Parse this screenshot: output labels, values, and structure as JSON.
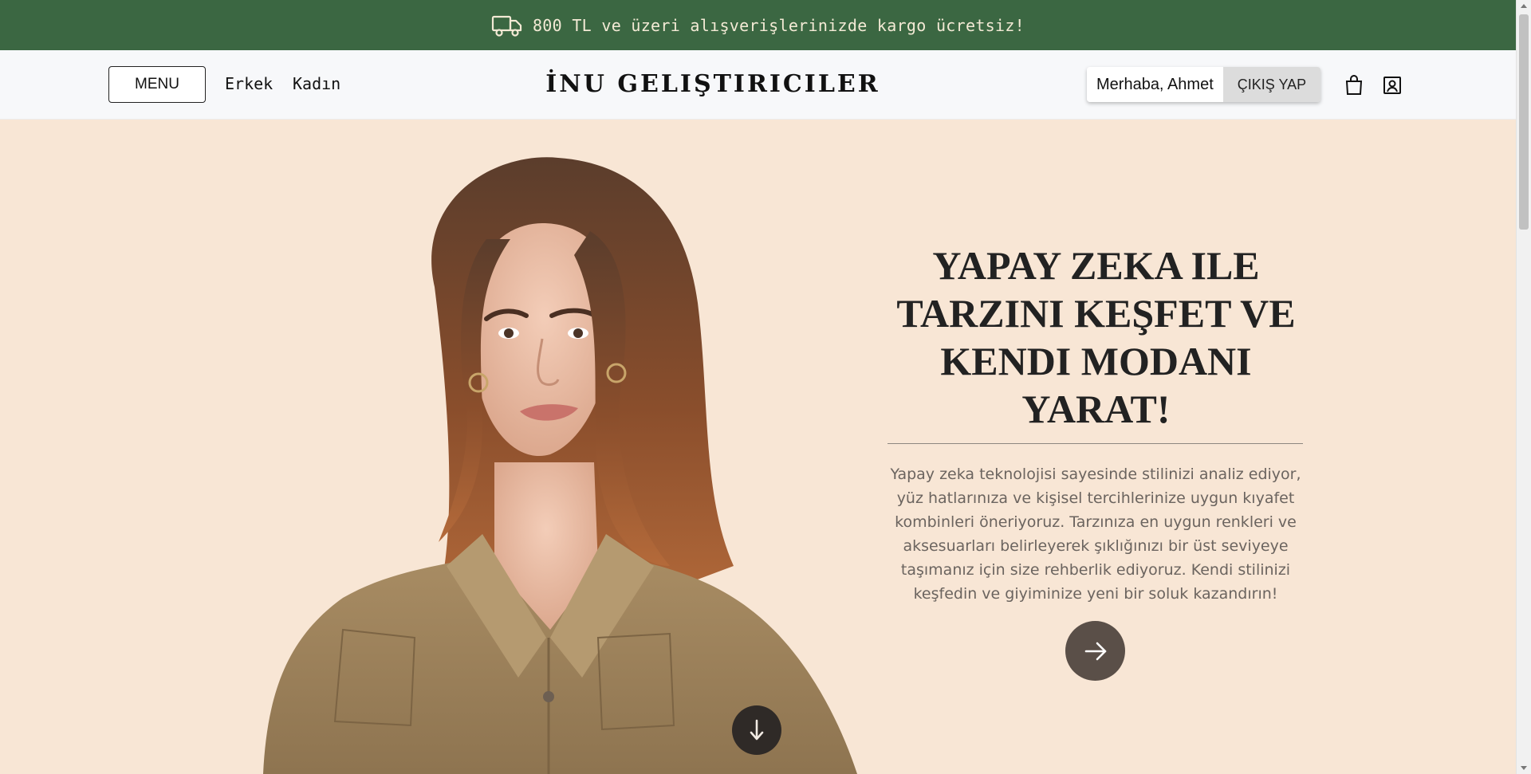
{
  "announcement": {
    "icon": "truck-icon",
    "text": "800 TL ve üzeri alışverişlerinizde kargo ücretsiz!"
  },
  "header": {
    "menu_label": "MENU",
    "nav": [
      "Erkek",
      "Kadın"
    ],
    "brand": "İNU GELIŞTIRICILER",
    "greeting": "Merhaba, Ahmet",
    "logout_label": "ÇIKIŞ YAP",
    "icons": [
      "shopping-bag-icon",
      "user-account-icon"
    ]
  },
  "hero": {
    "image": "woman-in-khaki-shirt-photo",
    "headline": "YAPAY ZEKA ILE TARZINI KEŞFET VE KENDI MODANI YARAT!",
    "description": "Yapay zeka teknolojisi sayesinde stilinizi analiz ediyor, yüz hatlarınıza ve kişisel tercihlerinize uygun kıyafet kombinleri öneriyoruz. Tarzınıza en uygun renkleri ve aksesuarları belirleyerek şıklığınızı bir üst seviyeye taşımanız için size rehberlik ediyoruz. Kendi stilinizi keşfedin ve giyiminize yeni bir soluk kazandırın!",
    "cta_icon": "arrow-right-icon",
    "scroll_icon": "arrow-down-icon"
  },
  "colors": {
    "topbar": "#3b6742",
    "hero_bg": "#f8e6d5",
    "cta_bg": "#5a4f48"
  }
}
